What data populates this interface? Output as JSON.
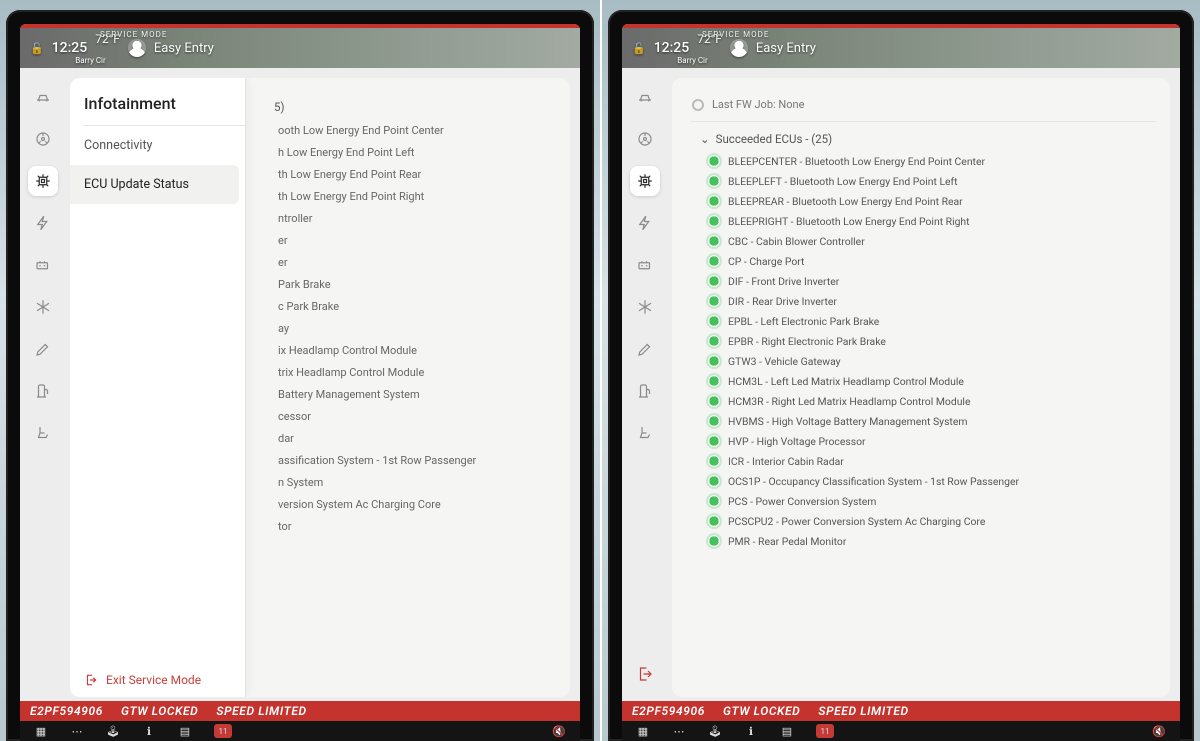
{
  "status": {
    "service_mode": "SERVICE MODE",
    "time": "12:25",
    "temp": "72°F",
    "location": "Barry Cir",
    "profile": "Easy Entry"
  },
  "left": {
    "heading": "Infotainment",
    "menu": [
      {
        "label": "Connectivity",
        "selected": false
      },
      {
        "label": "ECU Update Status",
        "selected": true
      }
    ],
    "exit_label": "Exit Service Mode",
    "group_count_fragment": "5)",
    "rows": [
      "ooth Low Energy End Point Center",
      "h Low Energy End Point Left",
      "th Low Energy End Point Rear",
      "th Low Energy End Point Right",
      "ntroller",
      "er",
      "er",
      "Park Brake",
      "c Park Brake",
      "ay",
      "ix Headlamp Control Module",
      "trix Headlamp Control Module",
      "Battery Management System",
      "cessor",
      "dar",
      "assification System - 1st Row Passenger",
      "n System",
      "version System Ac Charging Core",
      "tor"
    ]
  },
  "right": {
    "fwjob": "Last FW Job: None",
    "group_label": "Succeeded ECUs - (25)",
    "ecus": [
      "BLEEPCENTER - Bluetooth Low Energy End Point Center",
      "BLEEPLEFT - Bluetooth Low Energy End Point Left",
      "BLEEPREAR - Bluetooth Low Energy End Point Rear",
      "BLEEPRIGHT - Bluetooth Low Energy End Point Right",
      "CBC - Cabin Blower Controller",
      "CP - Charge Port",
      "DIF - Front Drive Inverter",
      "DIR - Rear Drive Inverter",
      "EPBL - Left Electronic Park Brake",
      "EPBR - Right Electronic Park Brake",
      "GTW3 - Vehicle Gateway",
      "HCM3L - Left Led Matrix Headlamp Control Module",
      "HCM3R - Right Led Matrix Headlamp Control Module",
      "HVBMS - High Voltage Battery Management System",
      "HVP - High Voltage Processor",
      "ICR - Interior Cabin Radar",
      "OCS1P - Occupancy Classification System - 1st Row Passenger",
      "PCS - Power Conversion System",
      "PCSCPU2 - Power Conversion System Ac Charging Core",
      "PMR - Rear Pedal Monitor"
    ]
  },
  "banner": {
    "vin_fragment": "E2PF594906",
    "gtw": "GTW LOCKED",
    "speed": "SPEED LIMITED"
  },
  "dock": {
    "date_badge": "11"
  },
  "sidebar_icons": [
    "car",
    "wheel",
    "cpu",
    "bolt",
    "battery",
    "snow",
    "pencil",
    "fuel",
    "seat"
  ]
}
